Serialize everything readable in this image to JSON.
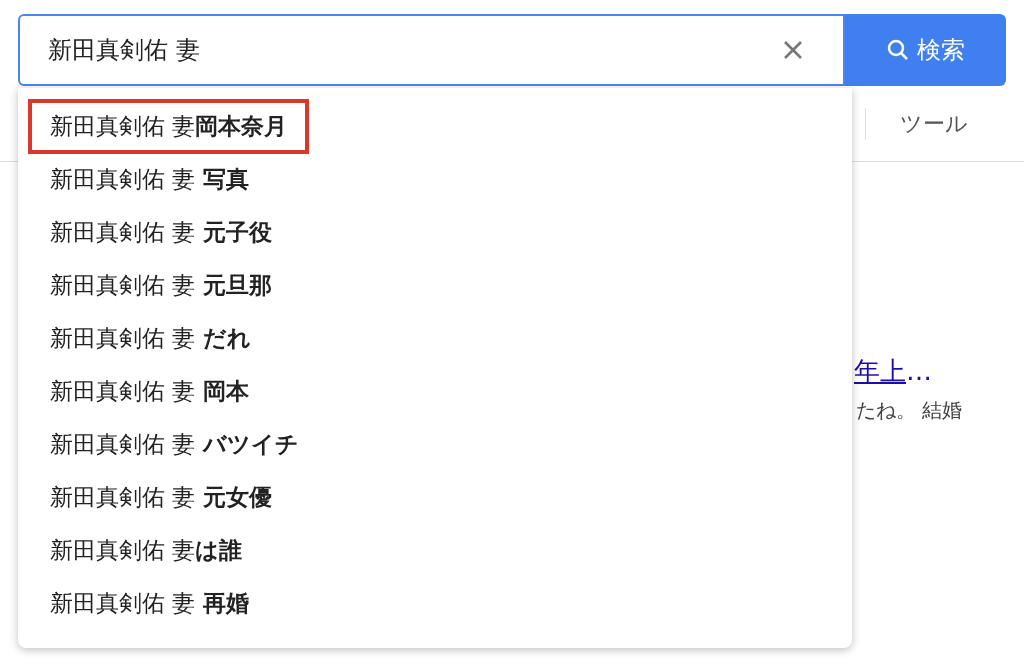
{
  "search": {
    "value": "新田真剣佑 妻",
    "button": "検索"
  },
  "toolbar": {
    "tools": "ツール"
  },
  "result": {
    "title": "年上…",
    "snippet": "たね。 結婚"
  },
  "suggestions": [
    {
      "text": "新田真剣佑 妻**岡本奈月**",
      "highlighted": true
    },
    {
      "text": "新田真剣佑 妻 **写真**",
      "highlighted": false
    },
    {
      "text": "新田真剣佑 妻 **元子役**",
      "highlighted": false
    },
    {
      "text": "新田真剣佑 妻 **元旦那**",
      "highlighted": false
    },
    {
      "text": "新田真剣佑 妻 **だれ**",
      "highlighted": false
    },
    {
      "text": "新田真剣佑 妻 **岡本**",
      "highlighted": false
    },
    {
      "text": "新田真剣佑 妻 **バツイチ**",
      "highlighted": false
    },
    {
      "text": "新田真剣佑 妻 **元女優**",
      "highlighted": false
    },
    {
      "text": "新田真剣佑 妻**は誰**",
      "highlighted": false
    },
    {
      "text": "新田真剣佑 妻 **再婚**",
      "highlighted": false
    }
  ]
}
